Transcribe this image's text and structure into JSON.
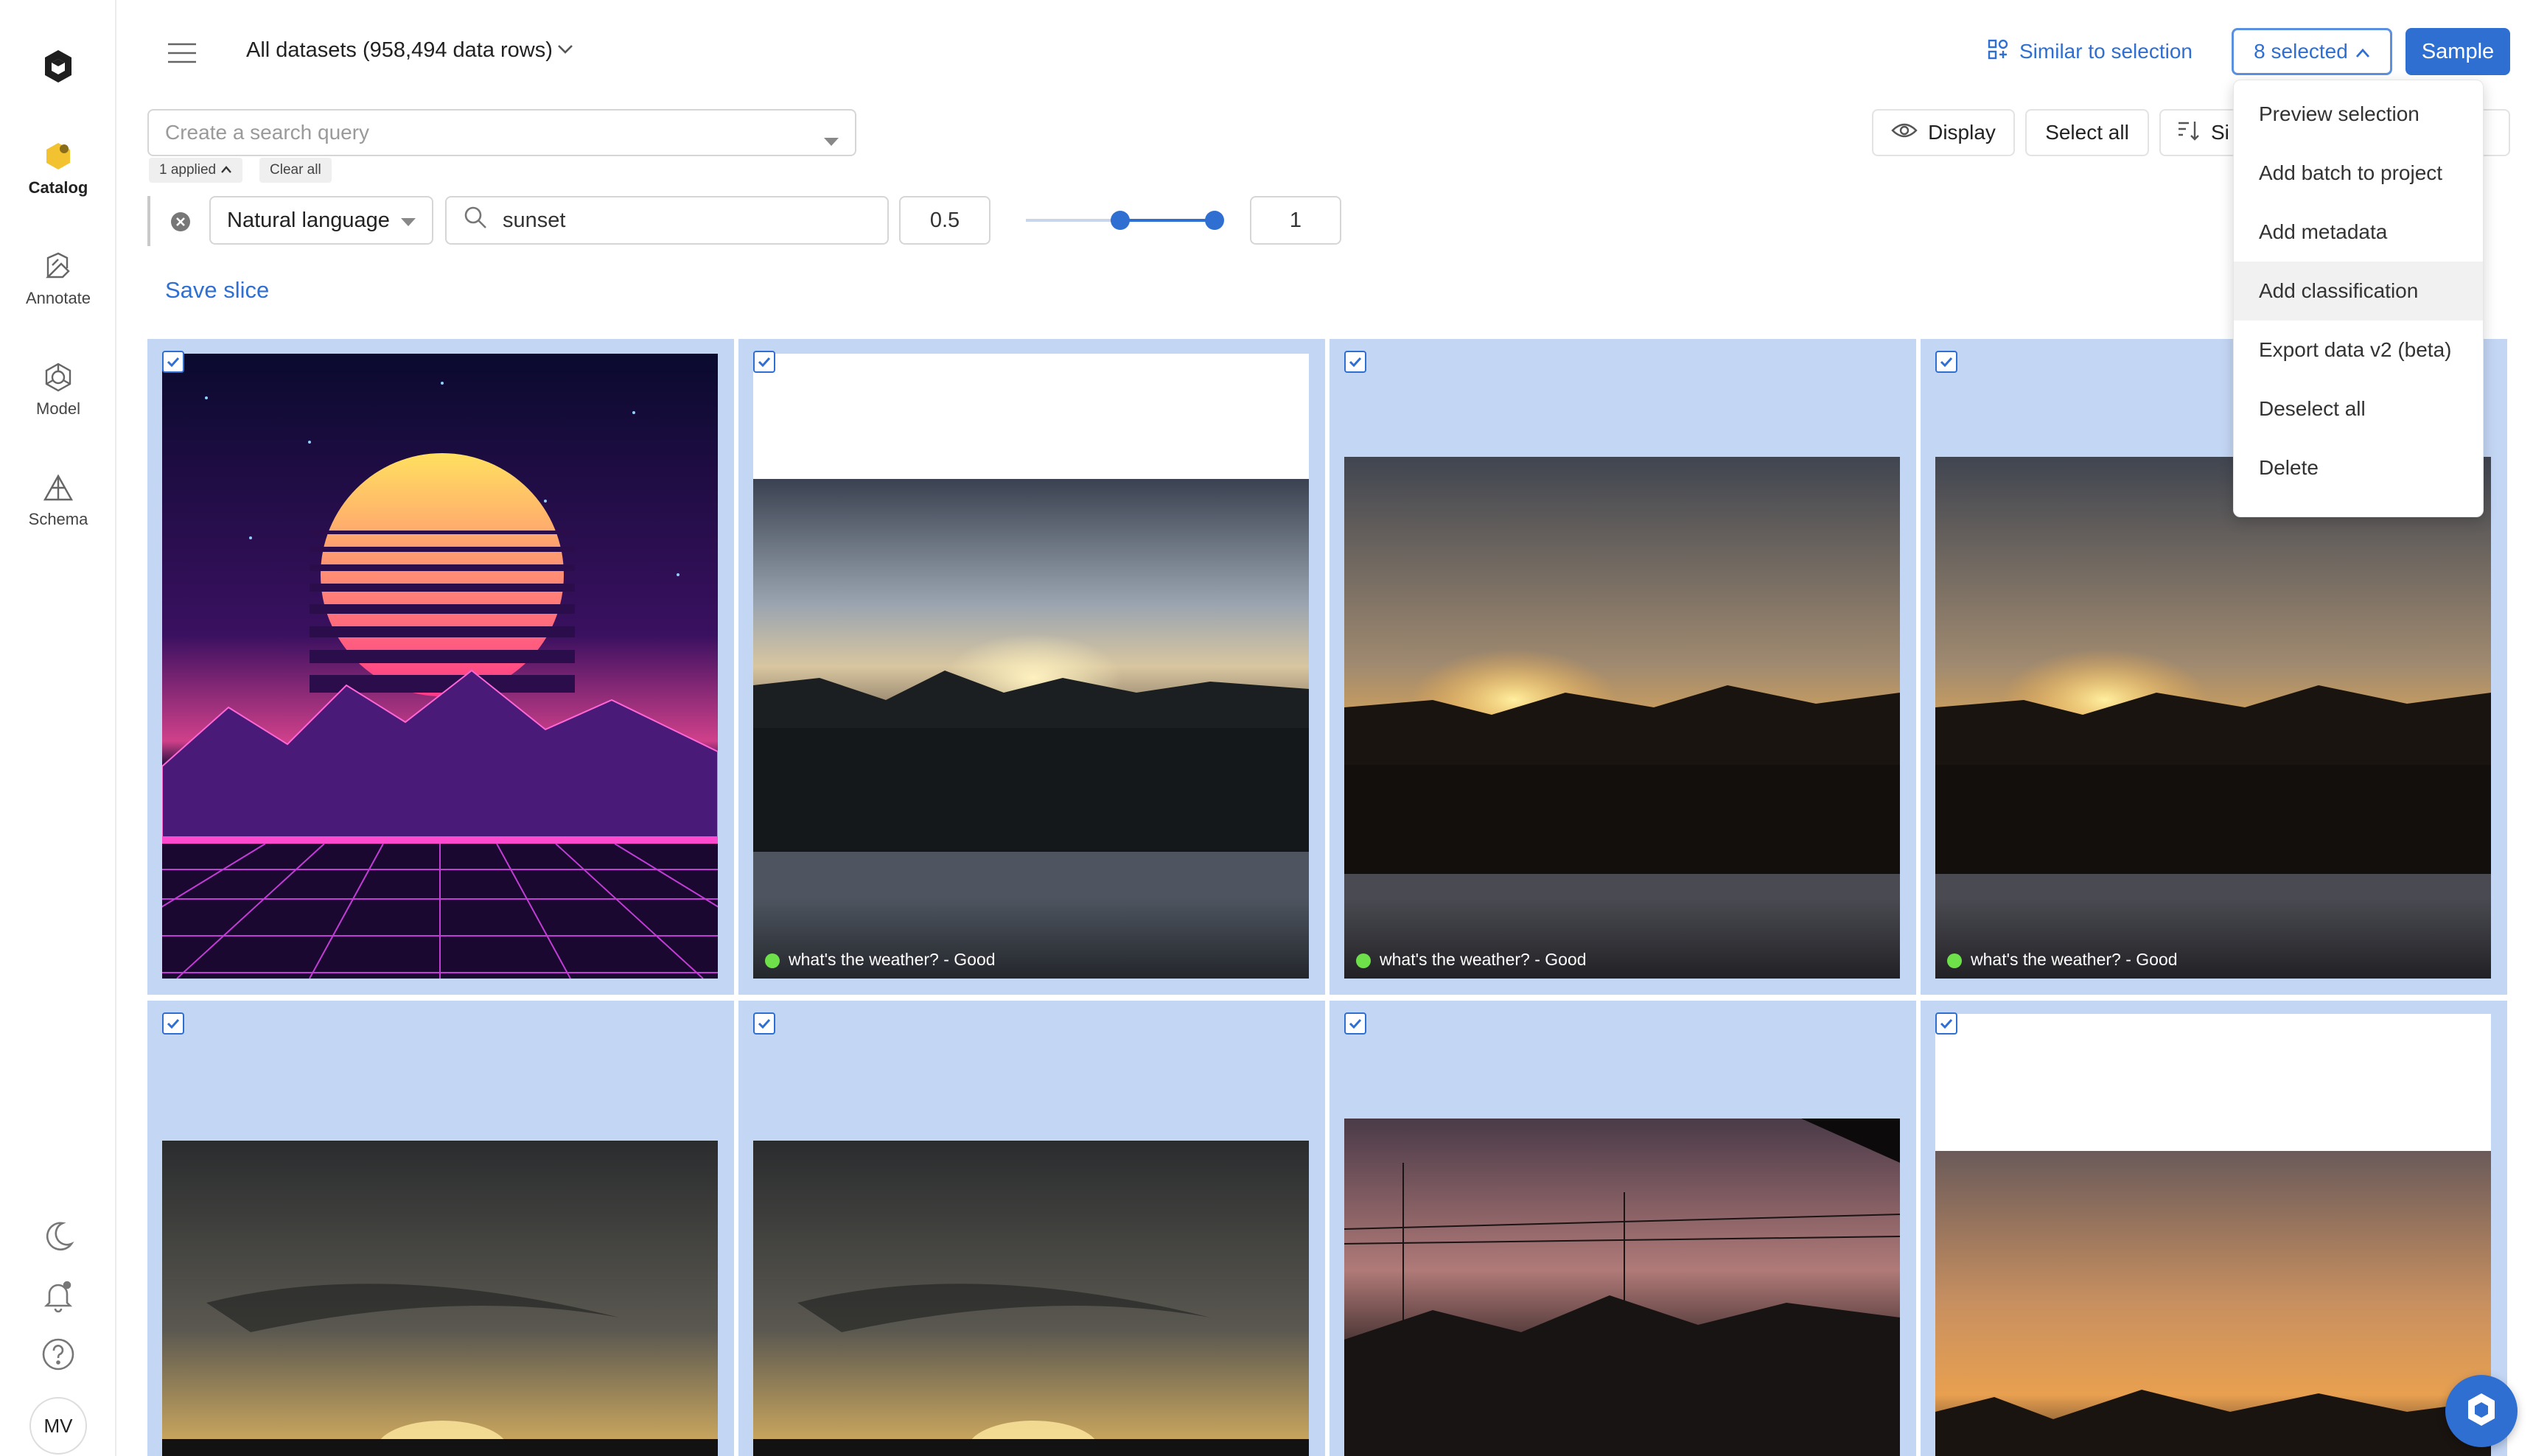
{
  "rail": {
    "items": [
      {
        "label": "Catalog",
        "icon": "catalog-icon"
      },
      {
        "label": "Annotate",
        "icon": "annotate-icon"
      },
      {
        "label": "Model",
        "icon": "model-icon"
      },
      {
        "label": "Schema",
        "icon": "schema-icon"
      }
    ],
    "bottom_icons": [
      "moon-icon",
      "bell-icon",
      "help-icon"
    ],
    "avatar": "MV"
  },
  "header": {
    "dataset_title": "All datasets (958,494 data rows)",
    "similar_label": "Similar to selection",
    "selected_label": "8 selected",
    "sample_label": "Sample"
  },
  "search": {
    "placeholder": "Create a search query",
    "applied_label": "1 applied",
    "clear_label": "Clear all"
  },
  "toolbar": {
    "display_label": "Display",
    "select_all_label": "Select all",
    "sort_label": "Si"
  },
  "filter": {
    "mode": "Natural language",
    "term": "sunset",
    "min": "0.5",
    "max": "1",
    "range": [
      0.5,
      1
    ]
  },
  "save_slice_label": "Save slice",
  "cards": [
    {
      "caption": ""
    },
    {
      "caption": "what's the weather? - Good"
    },
    {
      "caption": "what's the weather? - Good"
    },
    {
      "caption": "what's the weather? - Good"
    },
    {
      "caption": ""
    },
    {
      "caption": ""
    },
    {
      "caption": ""
    },
    {
      "caption": ""
    }
  ],
  "dropdown": {
    "items": [
      "Preview selection",
      "Add batch to project",
      "Add metadata",
      "Add classification",
      "Export data v2 (beta)",
      "Deselect all",
      "Delete"
    ]
  },
  "colors": {
    "accent": "#2f6fd1",
    "selected_card": "#c3d6f4",
    "status_good": "#6ee04a"
  }
}
